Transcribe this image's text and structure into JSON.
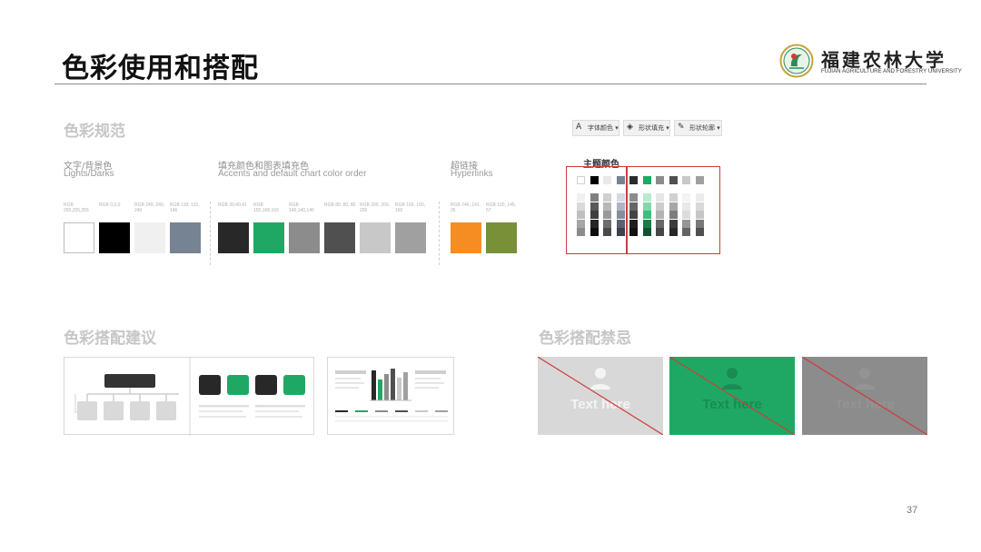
{
  "slide": {
    "title": "色彩使用和搭配",
    "page_number": "37"
  },
  "logo": {
    "name_cn": "福建农林大学",
    "name_en": "FUJIAN AGRICULTURE AND FORESTRY UNIVERSITY"
  },
  "palette": {
    "heading": "色彩规范",
    "groups": [
      {
        "title_cn": "文字/背景色",
        "title_en": "Lights/Darks",
        "swatches": [
          {
            "label": "RGB 255,255,255",
            "color": "#ffffff"
          },
          {
            "label": "RGB 0,0,0",
            "color": "#000000"
          },
          {
            "label": "RGB 240, 240, 240",
            "color": "#f0f0f0"
          },
          {
            "label": "RGB 118, 131, 146",
            "color": "#768392"
          }
        ]
      },
      {
        "title_cn": "填充颜色和图表填充色",
        "title_en": "Accents and default chart color order",
        "swatches": [
          {
            "label": "RGB 39,40,41",
            "color": "#282829"
          },
          {
            "label": "RGB 155,168,169",
            "color": "#1fa863"
          },
          {
            "label": "RGB 140,140,140",
            "color": "#8c8c8c"
          },
          {
            "label": "RGB 80, 80, 80",
            "color": "#505050"
          },
          {
            "label": "RGB 200, 200, 200",
            "color": "#c8c8c8"
          },
          {
            "label": "RGB 160, 160, 160",
            "color": "#a0a0a0"
          }
        ]
      },
      {
        "title_cn": "超链接",
        "title_en": "Hyperlinks",
        "swatches": [
          {
            "label": "RGB 246, 141, 35",
            "color": "#f68d23"
          },
          {
            "label": "RGB 120, 145, 57",
            "color": "#789139"
          }
        ]
      }
    ]
  },
  "toolbar": {
    "font_color_label": "字体颜色 ▾",
    "shape_fill_label": "形状填充 ▾",
    "shape_outline_label": "形状轮廓 ▾"
  },
  "theme_panel": {
    "title": "主题颜色",
    "top_row": [
      "#ffffff",
      "#000000",
      "#e8e8e8",
      "#768392",
      "#2b2b2b",
      "#1fa863",
      "#8c8c8c",
      "#505050",
      "#c8c8c8",
      "#a0a0a0"
    ],
    "shade_rows": [
      [
        "#f0f0f0",
        "#7f7f7f",
        "#d0d0d0",
        "#d6dae0",
        "#8c8c8c",
        "#b6ebd0",
        "#e6e6e6",
        "#d0d0d0",
        "#f3f3f3",
        "#ececec"
      ],
      [
        "#d9d9d9",
        "#595959",
        "#b8b8b8",
        "#adb5bf",
        "#666666",
        "#7fd8aa",
        "#cccccc",
        "#a6a6a6",
        "#e8e8e8",
        "#d9d9d9"
      ],
      [
        "#bfbfbf",
        "#3f3f3f",
        "#9a9a9a",
        "#848f9c",
        "#444444",
        "#3bbf7c",
        "#b3b3b3",
        "#7d7d7d",
        "#dcdcdc",
        "#c6c6c6"
      ],
      [
        "#a6a6a6",
        "#262626",
        "#6e6e6e",
        "#59626e",
        "#1f1f1f",
        "#177d4a",
        "#686868",
        "#3c3c3c",
        "#969696",
        "#787878"
      ],
      [
        "#8c8c8c",
        "#0d0d0d",
        "#4a4a4a",
        "#3b424a",
        "#111111",
        "#0f5432",
        "#464646",
        "#282828",
        "#646464",
        "#505050"
      ]
    ]
  },
  "recommend": {
    "heading": "色彩搭配建议"
  },
  "forbidden": {
    "heading": "色彩搭配禁忌",
    "examples": [
      {
        "text": "Text here",
        "bg": "#d8d8d8",
        "fg": "#f4f4f4"
      },
      {
        "text": "Text here",
        "bg": "#1fa863",
        "fg": "#1a8b52"
      },
      {
        "text": "Text here",
        "bg": "#8c8c8c",
        "fg": "#949494"
      }
    ]
  },
  "colors": {
    "brand_green": "#1fa863",
    "cross_red": "#d03c3c"
  }
}
